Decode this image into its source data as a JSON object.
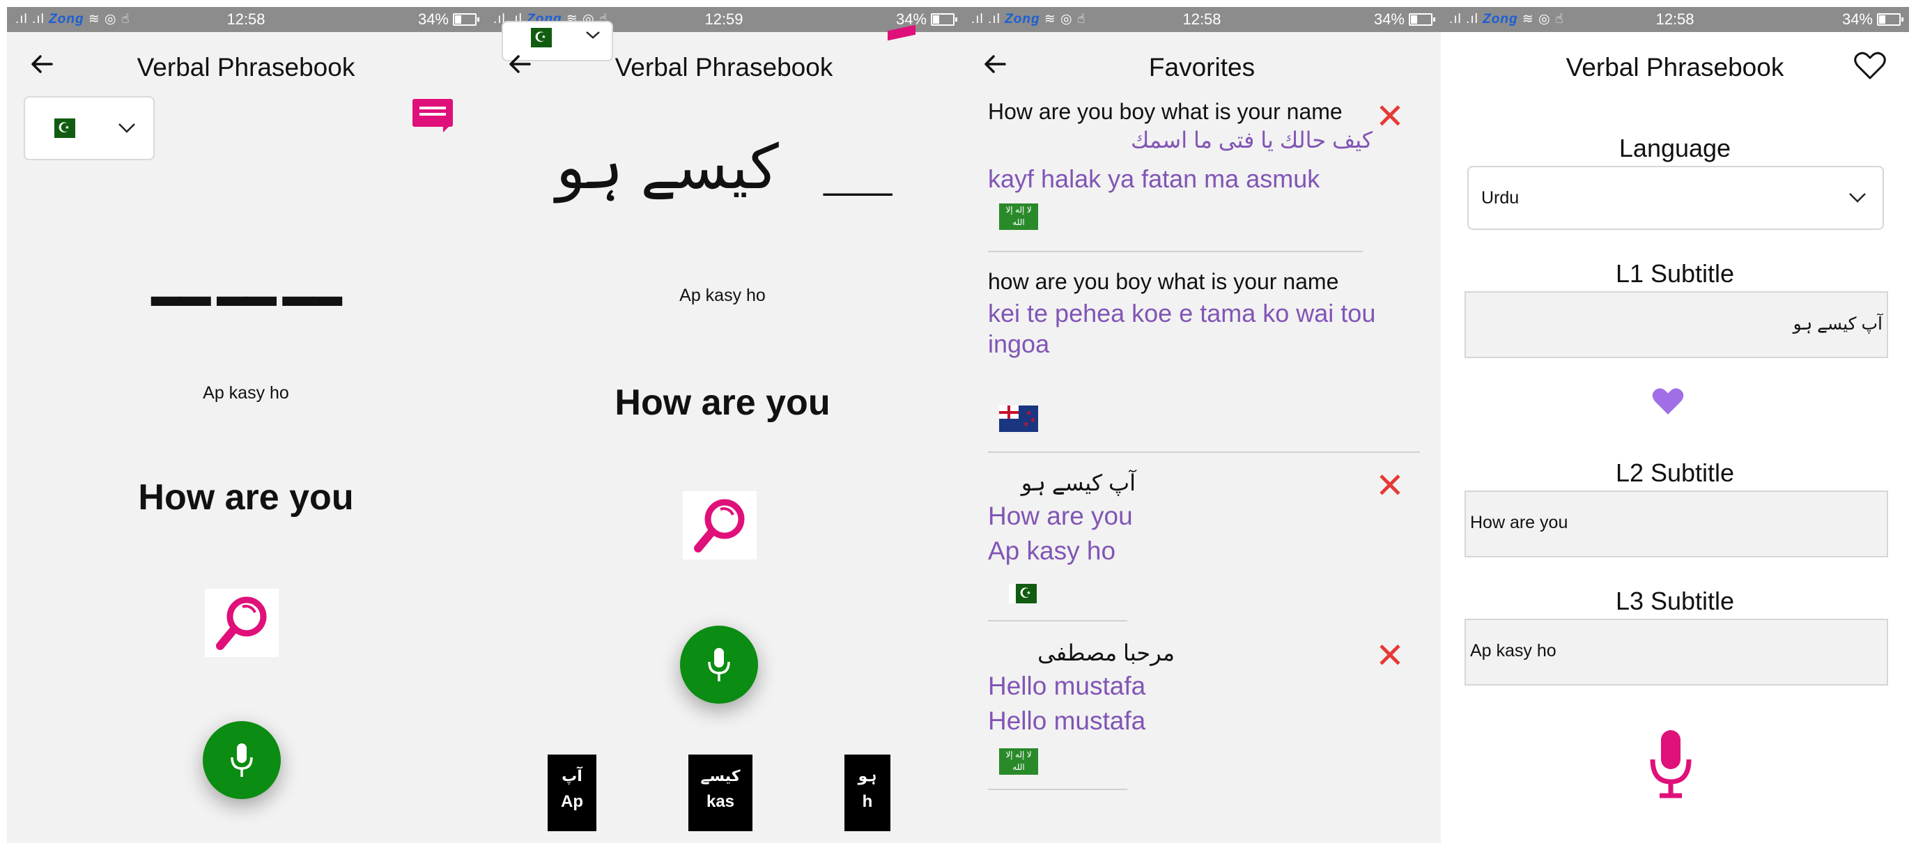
{
  "status": {
    "carrier": "Zong",
    "battery": "34%"
  },
  "screen1": {
    "time": "12:58",
    "title": "Verbal Phrasebook",
    "language_flag": "pakistan-flag",
    "blanks": "▬▬  ▬▬  ▬▬",
    "transliteration": "Ap kasy ho",
    "english": "How are you"
  },
  "screen2": {
    "time": "12:59",
    "title": "Verbal Phrasebook",
    "urdu_phrase": "کیسے  ہو",
    "blank": "__",
    "transliteration": "Ap kasy ho",
    "english": "How are you",
    "words": [
      {
        "urdu": "آپ",
        "latin": "Ap"
      },
      {
        "urdu": "کیسے",
        "latin": "kas"
      },
      {
        "urdu": "ہو",
        "latin": "h"
      }
    ]
  },
  "screen3": {
    "time": "12:58",
    "title": "Favorites",
    "items": [
      {
        "english": "How are you boy what is your name",
        "native": "كيف حالك يا فتى ما اسمك",
        "romanized": "kayf halak ya fatan ma asmuk",
        "flag": "saudi-arabia-flag",
        "flag_text": "لا إله إلا الله"
      },
      {
        "english": "how are you boy what is your name",
        "romanized": "kei te pehea koe e tama ko wai tou ingoa",
        "flag": "new-zealand-flag"
      },
      {
        "urdu": "آپ کیسے ہو",
        "english": "How are you",
        "romanized": "Ap kasy ho",
        "flag": "pakistan-flag"
      },
      {
        "urdu": "مرحبا مصطفى",
        "english": "Hello mustafa",
        "romanized": "Hello mustafa",
        "flag": "saudi-arabia-flag",
        "flag_text": "لا إله إلا الله"
      }
    ]
  },
  "screen4": {
    "time": "12:58",
    "title": "Verbal Phrasebook",
    "language_label": "Language",
    "language_value": "Urdu",
    "l1_label": "L1 Subtitle",
    "l1_value": "آپ کیسے ہو",
    "l2_label": "L2 Subtitle",
    "l2_value": "How are you",
    "l3_label": "L3 Subtitle",
    "l3_value": "Ap kasy ho"
  },
  "colors": {
    "green": "#0b8c12",
    "pink": "#e0107a",
    "purple": "#8155b5",
    "red": "#e53935"
  }
}
